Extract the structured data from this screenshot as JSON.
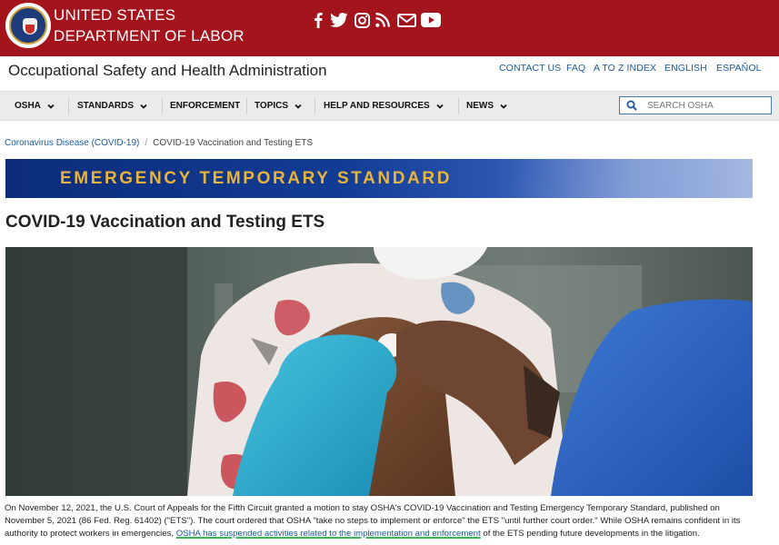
{
  "banner": {
    "dept_line1": "UNITED STATES",
    "dept_line2": "DEPARTMENT OF LABOR",
    "social_icons": [
      "facebook-icon",
      "twitter-icon",
      "instagram-icon",
      "rss-icon",
      "email-icon",
      "youtube-icon"
    ],
    "brand_color": "#a3141d"
  },
  "header": {
    "agency_name": "Occupational Safety and Health Administration",
    "utility_links": [
      "CONTACT US",
      "FAQ",
      "A TO Z INDEX",
      "ENGLISH",
      "ESPAÑOL"
    ]
  },
  "nav": {
    "items": [
      {
        "label": "OSHA",
        "has_dropdown": true
      },
      {
        "label": "STANDARDS",
        "has_dropdown": true
      },
      {
        "label": "ENFORCEMENT",
        "has_dropdown": false
      },
      {
        "label": "TOPICS",
        "has_dropdown": true
      },
      {
        "label": "HELP AND RESOURCES",
        "has_dropdown": true
      },
      {
        "label": "NEWS",
        "has_dropdown": true
      }
    ],
    "search_placeholder": "SEARCH OSHA"
  },
  "breadcrumb": {
    "parent": "Coronavirus Disease (COVID-19)",
    "separator": "/",
    "current": "COVID-19 Vaccination and Testing ETS"
  },
  "ets_banner": {
    "text": "EMERGENCY TEMPORARY STANDARD",
    "text_color": "#e9b43a",
    "bg_color": "#123c94"
  },
  "page": {
    "title": "COVID-19 Vaccination and Testing ETS"
  },
  "body": {
    "text_before": "On November 12, 2021, the U.S. Court of Appeals for the Fifth Circuit granted a motion to stay OSHA's COVID-19 Vaccination and Testing Emergency Temporary Standard, published on November 5, 2021 (86 Fed. Reg. 61402) (\"ETS\"). The court ordered that OSHA \"take no steps to implement or enforce\" the ETS \"until further court order.\" While OSHA remains confident in its authority to protect workers in emergencies, ",
    "highlight": "OSHA has suspended activities related to the implementation and enforcement",
    "text_after": " of the ETS pending future developments in the litigation.",
    "highlight_color": "#3cb45a"
  }
}
